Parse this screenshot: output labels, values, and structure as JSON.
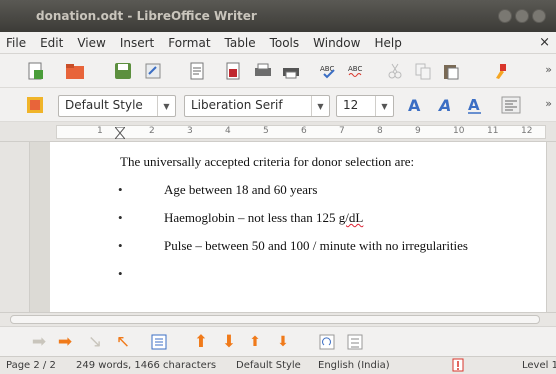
{
  "window": {
    "title": "donation.odt - LibreOffice Writer"
  },
  "menu": {
    "items": [
      "File",
      "Edit",
      "View",
      "Insert",
      "Format",
      "Table",
      "Tools",
      "Window",
      "Help"
    ],
    "close": "×"
  },
  "toolbar": {
    "more": "»"
  },
  "formatting": {
    "paragraph_style": "Default Style",
    "font_name": "Liberation Serif",
    "font_size": "12",
    "more": "»"
  },
  "ruler": {
    "ticks": [
      "1",
      "2",
      "3",
      "4",
      "5",
      "6",
      "7",
      "8",
      "9",
      "10",
      "11",
      "12"
    ]
  },
  "document": {
    "intro": "The universally accepted criteria for donor selection are:",
    "bullet_char": "•",
    "bullets": [
      {
        "before": "Age between 18 and 60 years",
        "flagged": ""
      },
      {
        "before": "Haemoglobin – not less than 125 ",
        "flagged": "g/dL"
      },
      {
        "before": "Pulse – between 50 and 100 / minute with no irregularities",
        "flagged": ""
      },
      {
        "before": "",
        "flagged": ""
      }
    ]
  },
  "statusbar": {
    "page": "Page 2 / 2",
    "words": "249 words, 1466 characters",
    "style": "Default Style",
    "language": "English (India)",
    "level": "Level 1"
  },
  "colors": {
    "accent": "#3b6ec4",
    "orange": "#f07a1a",
    "red": "#d9362b"
  }
}
